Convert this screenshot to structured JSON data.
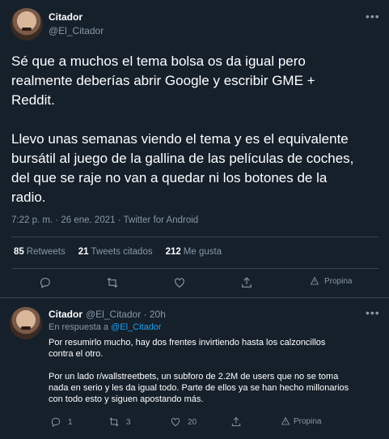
{
  "main": {
    "display_name": "Citador",
    "handle": "@El_Citador",
    "text": "Sé que a muchos el tema bolsa os da igual pero\nrealmente deberías abrir Google y escribir GME +\nReddit.\n\nLlevo unas semanas viendo el tema y es el equivalente\nbursátil al juego de la gallina de las películas de coches,\ndel que se raje no van a quedar ni los botones de la\nradio.",
    "timestamp": "7:22 p. m. · 26 ene. 2021 · Twitter for Android",
    "retweets_count": "85",
    "retweets_label": "Retweets",
    "quotes_count": "21",
    "quotes_label": "Tweets citados",
    "likes_count": "212",
    "likes_label": "Me gusta",
    "share_label": "Propina"
  },
  "reply": {
    "display_name": "Citador",
    "handle_time": "@El_Citador · 20h",
    "reply_prefix": "En respuesta a",
    "reply_to": "@El_Citador",
    "text": "Por resumirlo mucho, hay dos frentes invirtiendo hasta los calzoncillos\ncontra el otro.\n\nPor un lado r/wallstreetbets, un subforo de 2.2M de users que no se toma\nnada en serio y les da igual todo. Parte de ellos ya se han hecho millonarios\ncon todo esto y siguen apostando más.",
    "replies": "1",
    "retweets": "3",
    "likes": "20",
    "share_label": "Propina"
  },
  "icons": {
    "more": "more-icon",
    "reply": "reply-icon",
    "retweet": "retweet-icon",
    "like": "heart-icon",
    "share": "share-icon",
    "tip": "tip-icon"
  },
  "colors": {
    "background": "#15202b",
    "secondary_text": "#8899a6",
    "link": "#1da1f2",
    "border": "#38444d"
  }
}
